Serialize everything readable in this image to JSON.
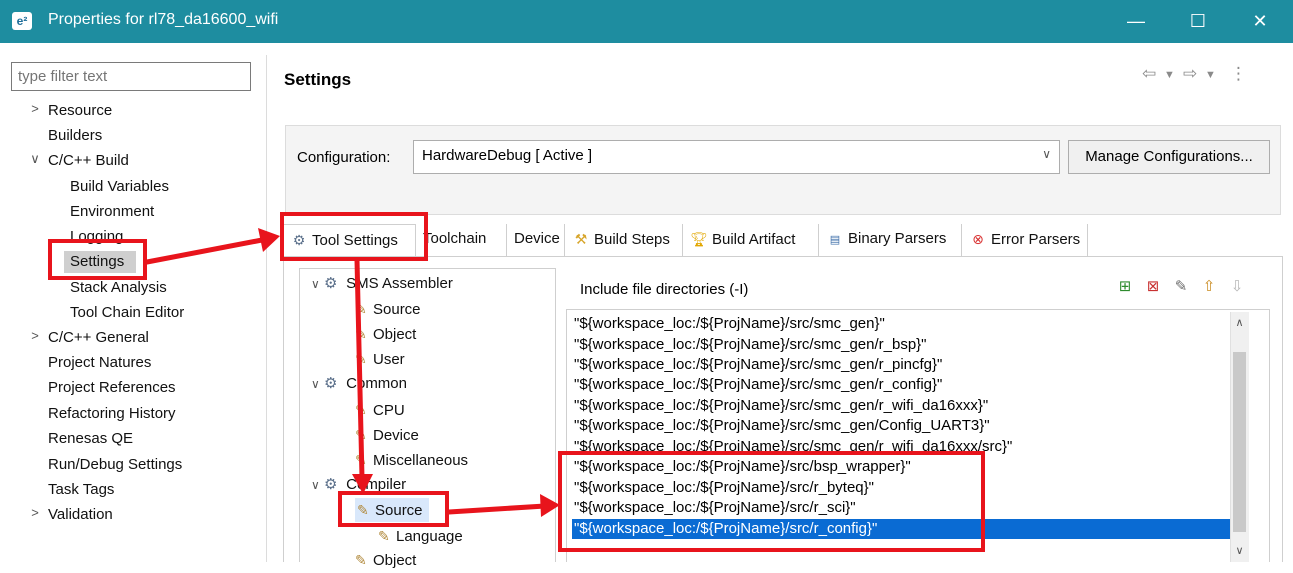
{
  "window": {
    "title": "Properties for rl78_da16600_wifi",
    "app_icon": "e²",
    "controls": {
      "minimize": "—",
      "maximize": "☐",
      "close": "✕"
    }
  },
  "left": {
    "filter_placeholder": "type filter text",
    "tree": [
      {
        "label": "Resource",
        "twisty": ">"
      },
      {
        "label": "Builders"
      },
      {
        "label": "C/C++ Build",
        "twisty": "∨"
      },
      {
        "label": "Build Variables"
      },
      {
        "label": "Environment"
      },
      {
        "label": "Logging"
      },
      {
        "label": "Settings"
      },
      {
        "label": "Stack Analysis"
      },
      {
        "label": "Tool Chain Editor"
      },
      {
        "label": "C/C++ General",
        "twisty": ">"
      },
      {
        "label": "Project Natures"
      },
      {
        "label": "Project References"
      },
      {
        "label": "Refactoring History"
      },
      {
        "label": "Renesas QE"
      },
      {
        "label": "Run/Debug Settings"
      },
      {
        "label": "Task Tags"
      },
      {
        "label": "Validation",
        "twisty": ">"
      }
    ]
  },
  "right": {
    "title": "Settings",
    "nav_icons": [
      "back-icon",
      "dropdown-icon",
      "forward-icon",
      "dropdown-icon",
      "menu-icon"
    ],
    "configuration_label": "Configuration:",
    "configuration_value": "HardwareDebug  [ Active ]",
    "manage_button": "Manage Configurations...",
    "tabs": [
      {
        "label": "Tool Settings",
        "icon": "gear-icon"
      },
      {
        "label": "Toolchain"
      },
      {
        "label": "Device"
      },
      {
        "label": "Build Steps",
        "icon": "build-steps-icon"
      },
      {
        "label": "Build Artifact",
        "icon": "trophy-icon"
      },
      {
        "label": "Binary Parsers",
        "icon": "binary-icon"
      },
      {
        "label": "Error Parsers",
        "icon": "error-icon"
      }
    ],
    "tool_tree": [
      {
        "label": "SMS Assembler",
        "twisty": "∨"
      },
      {
        "label": "Source"
      },
      {
        "label": "Object"
      },
      {
        "label": "User"
      },
      {
        "label": "Common",
        "twisty": "∨"
      },
      {
        "label": "CPU"
      },
      {
        "label": "Device"
      },
      {
        "label": "Miscellaneous"
      },
      {
        "label": "Compiler",
        "twisty": "∨"
      },
      {
        "label": "Source"
      },
      {
        "label": "Language"
      },
      {
        "label": "Object"
      }
    ],
    "include_title": "Include file directories (-I)",
    "include_items": [
      "\"${workspace_loc:/${ProjName}/src/smc_gen}\"",
      "\"${workspace_loc:/${ProjName}/src/smc_gen/r_bsp}\"",
      "\"${workspace_loc:/${ProjName}/src/smc_gen/r_pincfg}\"",
      "\"${workspace_loc:/${ProjName}/src/smc_gen/r_config}\"",
      "\"${workspace_loc:/${ProjName}/src/smc_gen/r_wifi_da16xxx}\"",
      "\"${workspace_loc:/${ProjName}/src/smc_gen/Config_UART3}\"",
      "\"${workspace_loc:/${ProjName}/src/smc_gen/r_wifi_da16xxx/src}\"",
      "\"${workspace_loc:/${ProjName}/src/bsp_wrapper}\"",
      "\"${workspace_loc:/${ProjName}/src/r_byteq}\"",
      "\"${workspace_loc:/${ProjName}/src/r_sci}\"",
      "\"${workspace_loc:/${ProjName}/src/r_config}\""
    ],
    "selected_include_index": 10
  },
  "colors": {
    "titlebar": "#1e8da0",
    "selection": "#0a6bd3",
    "annotation": "#e8141c"
  }
}
